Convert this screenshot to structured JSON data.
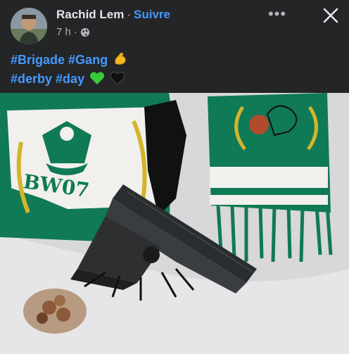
{
  "post": {
    "author": "Rachid Lem",
    "separator": "·",
    "follow_label": "Suivre",
    "time": "7 h",
    "time_separator": "·",
    "privacy_icon": "globe-icon",
    "more_icon": "more-dots-icon",
    "more_glyph": "•••",
    "close_icon": "close-icon",
    "lines": [
      {
        "tags": [
          "#Brigade",
          "#Gang"
        ],
        "emoji": [
          "flexed-biceps-emoji"
        ]
      },
      {
        "tags": [
          "#derby",
          "#day"
        ],
        "emoji": [
          "green-heart-emoji",
          "black-heart-emoji"
        ]
      }
    ]
  },
  "photo": {
    "scarf_text": "BW07"
  },
  "colors": {
    "background": "#242526",
    "text": "#e4e6eb",
    "secondary_text": "#b0b3b8",
    "link": "#4599ff",
    "scarf_green": "#0f7a55",
    "scarf_white": "#f1f0ec",
    "scarf_gold": "#d4b42a"
  }
}
